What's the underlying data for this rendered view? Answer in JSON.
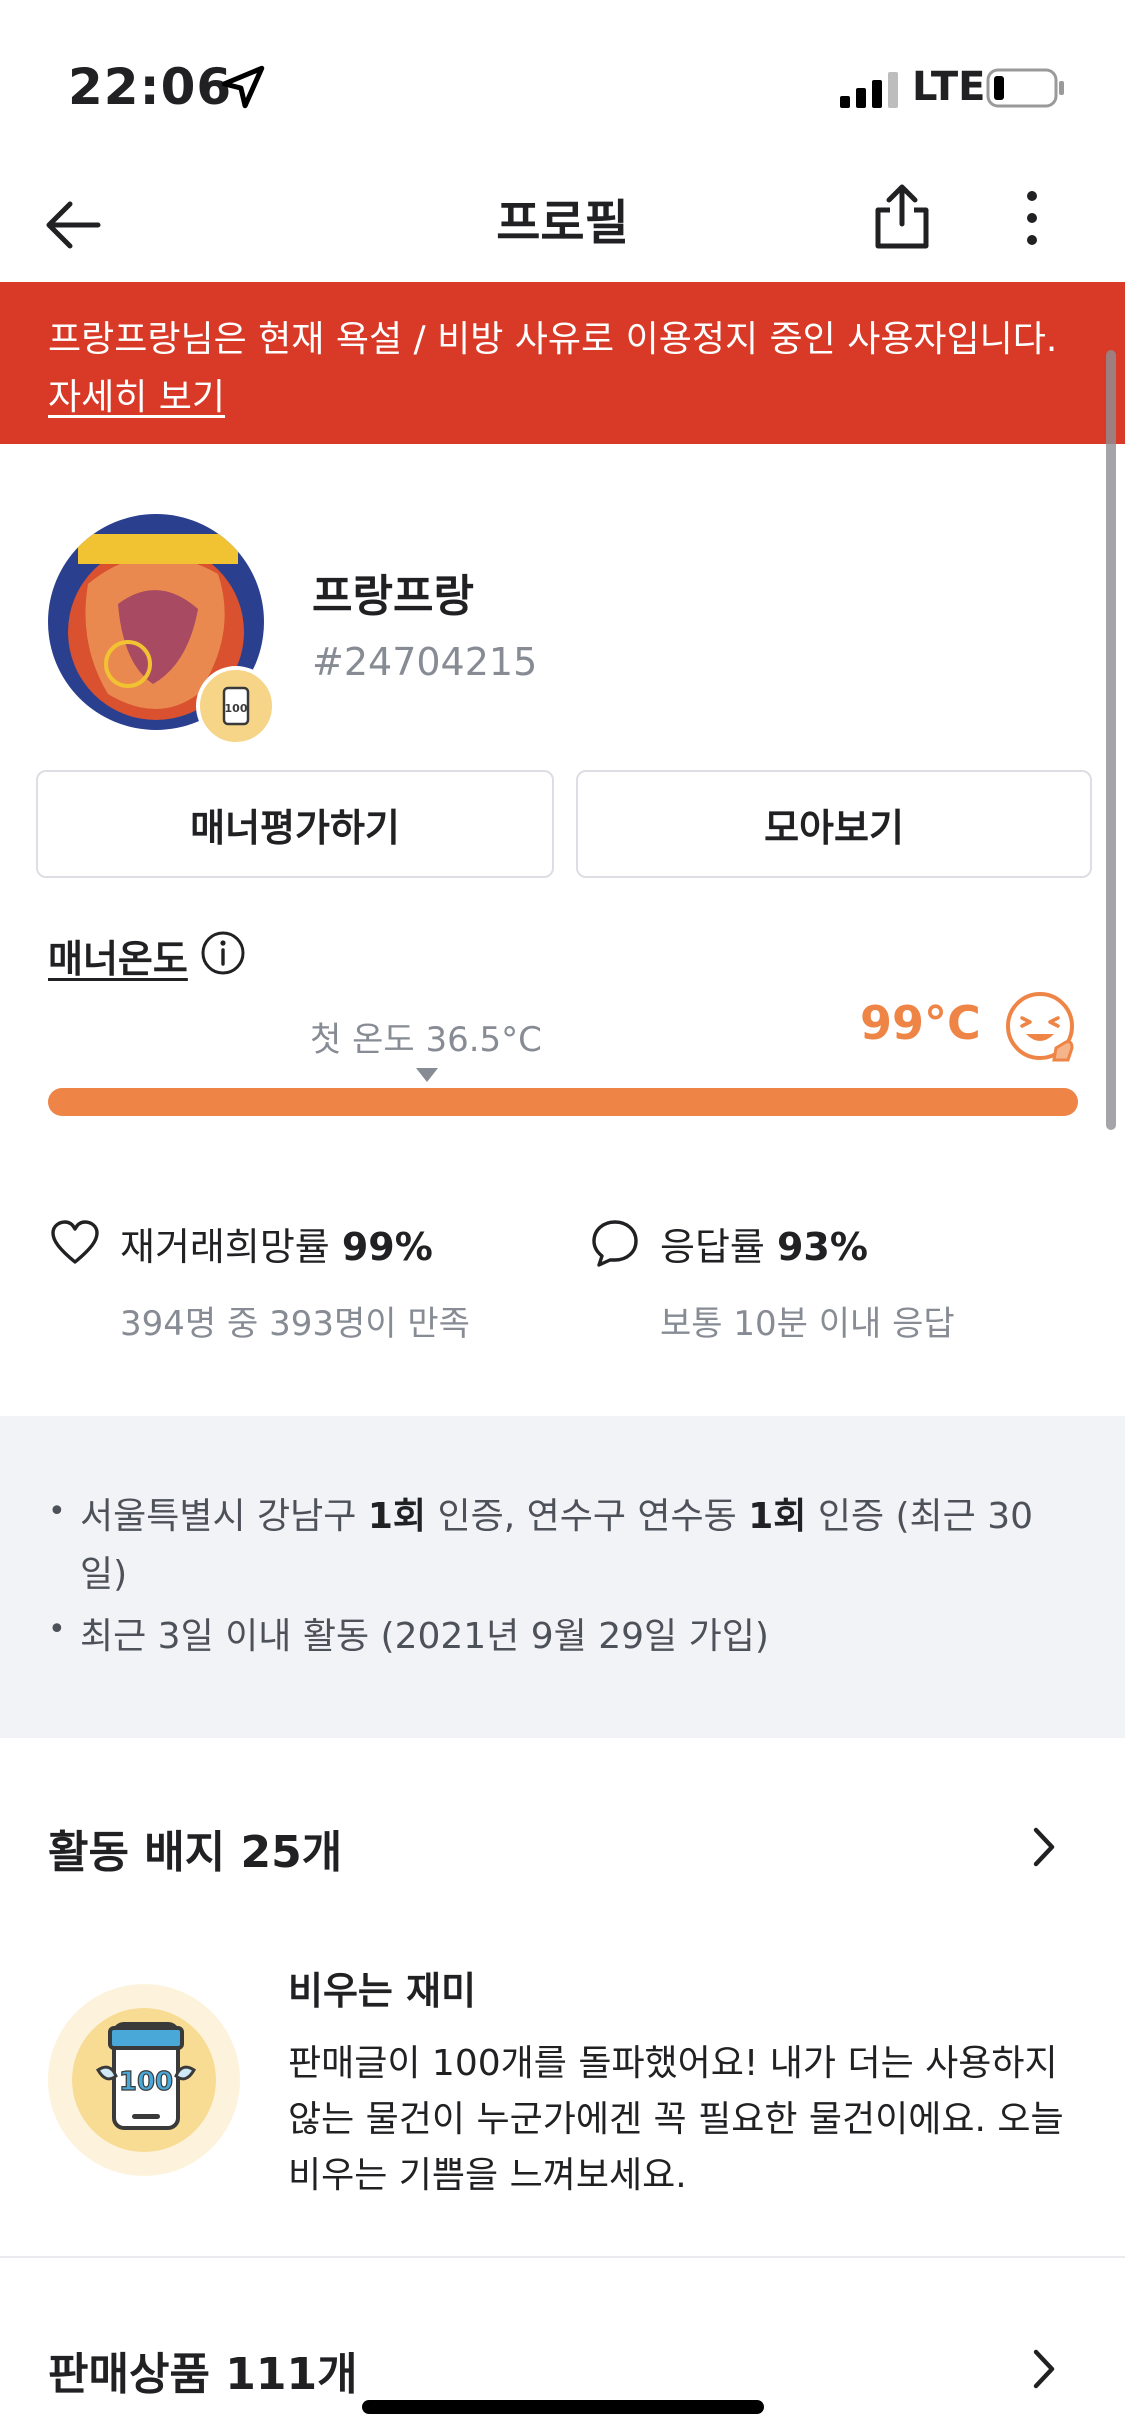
{
  "status_bar": {
    "time": "22:06",
    "network": "LTE"
  },
  "nav": {
    "title": "프로필"
  },
  "banner": {
    "text": "프랑프랑님은 현재 욕설 / 비방 사유로 이용정지 중인 사용자입니다.",
    "link": "자세히 보기",
    "color": "#d83a27"
  },
  "profile": {
    "nickname": "프랑프랑",
    "user_id": "#24704215",
    "avatar_badge": "100"
  },
  "buttons": {
    "manner_rate": "매너평가하기",
    "collect": "모아보기"
  },
  "manner": {
    "label": "매너온도",
    "first_temp": "첫 온도 36.5°C",
    "temperature": "99°C",
    "fill_fraction": 0.99,
    "accent_color": "#ee8547"
  },
  "stats": {
    "rebuy_label": "재거래희망률",
    "rebuy_value": "99%",
    "rebuy_sub": "394명 중 393명이 만족",
    "response_label": "응답률",
    "response_value": "93%",
    "response_sub": "보통 10분 이내 응답"
  },
  "info": {
    "line1_a": "서울특별시 강남구 ",
    "line1_b": "1회",
    "line1_c": " 인증, 연수구 연수동 ",
    "line1_d": "1회",
    "line1_e": " 인증 (최근 30일)",
    "line2": "최근 3일 이내 활동 (2021년 9월 29일 가입)"
  },
  "badges_section": {
    "title": "활동 배지 25개",
    "badge_name": "비우는 재미",
    "badge_icon_text": "100",
    "badge_desc": "판매글이 100개를 돌파했어요! 내가 더는 사용하지 않는 물건이 누군가에겐 꼭 필요한 물건이에요. 오늘 비우는 기쁨을 느껴보세요."
  },
  "products_section": {
    "title": "판매상품 111개"
  },
  "icons": [
    "location-arrow-icon",
    "signal-icon",
    "battery-icon",
    "back-arrow-icon",
    "share-icon",
    "more-vertical-icon",
    "info-icon",
    "smile-face-icon",
    "heart-icon",
    "chat-bubble-icon",
    "chevron-right-icon"
  ]
}
